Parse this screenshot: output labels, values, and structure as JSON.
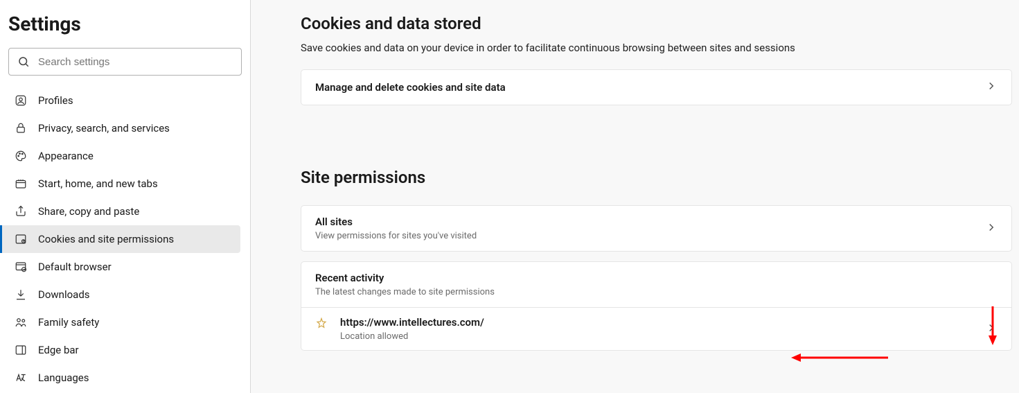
{
  "sidebar": {
    "title": "Settings",
    "search_placeholder": "Search settings",
    "items": [
      {
        "label": "Profiles"
      },
      {
        "label": "Privacy, search, and services"
      },
      {
        "label": "Appearance"
      },
      {
        "label": "Start, home, and new tabs"
      },
      {
        "label": "Share, copy and paste"
      },
      {
        "label": "Cookies and site permissions"
      },
      {
        "label": "Default browser"
      },
      {
        "label": "Downloads"
      },
      {
        "label": "Family safety"
      },
      {
        "label": "Edge bar"
      },
      {
        "label": "Languages"
      }
    ]
  },
  "main": {
    "cookies": {
      "title": "Cookies and data stored",
      "desc": "Save cookies and data on your device in order to facilitate continuous browsing between sites and sessions",
      "manage_label": "Manage and delete cookies and site data"
    },
    "permissions": {
      "title": "Site permissions",
      "all_sites_label": "All sites",
      "all_sites_sub": "View permissions for sites you've visited",
      "recent_label": "Recent activity",
      "recent_sub": "The latest changes made to site permissions",
      "site": {
        "url": "https://www.intellectures.com/",
        "status": "Location allowed"
      }
    }
  }
}
